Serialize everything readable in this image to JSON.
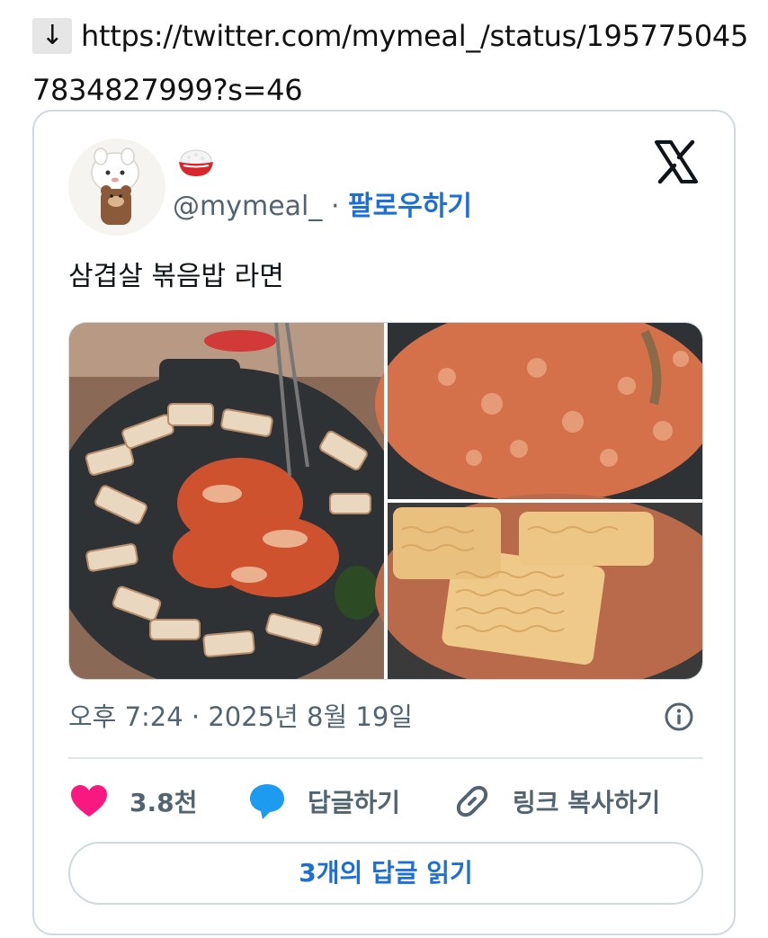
{
  "header": {
    "arrow_glyph": "↓",
    "url": "https://twitter.com/mymeal_/status/1957750457834827999?s=46"
  },
  "tweet": {
    "handle": "@mymeal_",
    "separator": "·",
    "follow_label": "팔로우하기",
    "text": "삼겹살 볶음밥 라면",
    "timestamp": "오후 7:24 · 2025년 8월 19일",
    "likes_count": "3.8천",
    "reply_label": "답글하기",
    "copy_link_label": "링크 복사하기",
    "read_replies_label": "3개의 답글 읽기"
  },
  "colors": {
    "follow_blue": "#1d6fd6",
    "like_pink": "#f91880",
    "reply_blue": "#1d9bf0",
    "border": "#cfd9de",
    "muted": "#536471"
  },
  "icons": {
    "x_logo": "x-logo-icon",
    "rice": "rice-bowl-icon",
    "heart": "heart-icon",
    "bubble": "speech-bubble-icon",
    "link": "link-icon",
    "info": "info-icon"
  }
}
